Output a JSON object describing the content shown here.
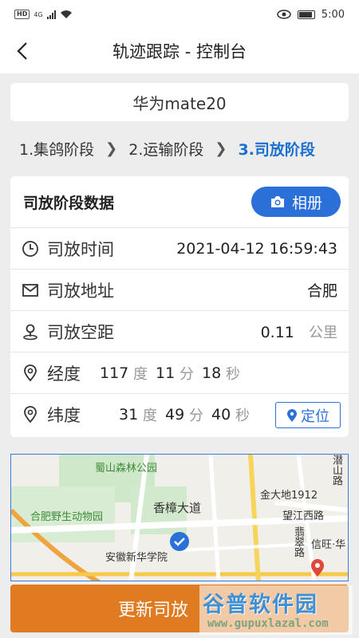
{
  "status_bar": {
    "hd_label": "HD",
    "signal_label": "4G",
    "time": "5:00",
    "icons": [
      "wifi-icon",
      "eye-icon",
      "battery-icon"
    ]
  },
  "header": {
    "title": "轨迹跟踪 - 控制台",
    "back_icon": "chevron-left-icon"
  },
  "device": {
    "name": "华为mate20"
  },
  "steps": [
    {
      "label": "1.集鸽阶段",
      "active": false
    },
    {
      "label": "2.运输阶段",
      "active": false
    },
    {
      "label": "3.司放阶段",
      "active": true
    }
  ],
  "release_card": {
    "title": "司放阶段数据",
    "album_button": "相册",
    "rows": {
      "time": {
        "label": "司放时间",
        "value": "2021-04-12 16:59:43"
      },
      "address": {
        "label": "司放地址",
        "value": "合肥"
      },
      "distance": {
        "label": "司放空距",
        "value": "0.11",
        "unit": "公里"
      },
      "longitude": {
        "label": "经度",
        "deg": "117",
        "min": "11",
        "sec": "18",
        "deg_unit": "度",
        "min_unit": "分",
        "sec_unit": "秒"
      },
      "latitude": {
        "label": "纬度",
        "deg": "31",
        "min": "49",
        "sec": "40",
        "deg_unit": "度",
        "min_unit": "分",
        "sec_unit": "秒"
      }
    },
    "locate_button": "定位"
  },
  "map": {
    "labels": {
      "park": "蜀山森林公园",
      "zoo": "合肥野生动物园",
      "road1": "香樟大道",
      "school": "安徽新华学院",
      "building": "金大地1912",
      "road2": "望江西路",
      "road3": "翡翠路",
      "road4": "潜山路",
      "poi": "信旺·华"
    }
  },
  "bottom_button": {
    "label": "更新司放"
  },
  "watermark": {
    "cn": "谷普软件园",
    "url": "www.gupuxlazal.com"
  },
  "colors": {
    "accent": "#2b6fd9",
    "step_active": "#1a6fd0",
    "action": "#e07b22"
  }
}
